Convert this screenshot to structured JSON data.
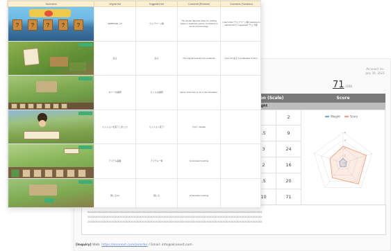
{
  "report": {
    "company": "Alconost Inc.",
    "date": "July 30, 2021",
    "score": "71",
    "score_max": "/100",
    "table": {
      "head_left": "ation (Scale)",
      "head_right": "Score",
      "sub_left": "ight",
      "rows": [
        {
          "left": ".5",
          "right": "9"
        },
        {
          "left": "3",
          "right": "24"
        },
        {
          "left": "2",
          "right": "16"
        },
        {
          "left": ".5",
          "right": "20"
        },
        {
          "left": "10",
          "right": "71"
        }
      ],
      "row0_right": "2"
    },
    "comment_lines": [
      "XXXXXXXXXXXXXXXXXXXXXXXXXXXXXXXXXXXXXXXXXXXXXXXXXXXXXXXXXXXXXXXXXXXXXXXXXXXXXXXXXXXXXXXXXXXXXXXXXXXXXXXXXXXXXX",
      "XXXXXXXXXXXXXXXXXXXXXXXXXXXXXXXXXXXXXXXXXXXXXXXXXXXXXXXXXXXXXXXXXXXXXXXXXXXXXXXXXXXXXXXXXXXXXXXXXXXXXXXXXXXXXX",
      "XXXXXXXXXXXXXXXXXXXXXXXXXXXXXXXXXXXXXXXXXXXXXXXXXXXXXXXXXXXXXXXXXXXXXXXXXXXXXXXXXXXXXXXXXXXXXXXXXXXXXXXXXXXXXX"
    ],
    "inquiry_label": "[Inquiry]",
    "inquiry_web_label": "Web:",
    "inquiry_url": "https://alconost.com/ja/order",
    "inquiry_email": "/ Email: info@alconost.com"
  },
  "chart_data": {
    "type": "radar",
    "title": "",
    "legend": [
      "Weight",
      "Score"
    ],
    "legend_position": "top",
    "axis_ticks": [
      "4",
      "3",
      "2",
      "1",
      "0"
    ],
    "spoke_labels": [
      "",
      "",
      "",
      "",
      ""
    ],
    "series": [
      {
        "name": "Weight",
        "values": [
          0.6,
          0.5,
          0.6,
          0.6,
          0.5
        ]
      },
      {
        "name": "Score",
        "values": [
          2.2,
          3.2,
          3.4,
          2.4,
          1.8
        ]
      }
    ],
    "rlim": [
      0,
      4
    ],
    "colors": {
      "Weight": "#7aa6d8",
      "Score": "#f0a078"
    }
  },
  "sheet": {
    "headers": [
      "Screenshot",
      "Original text",
      "Suggested text",
      "Comments (Reviewer)",
      "Comments (Translator)"
    ],
    "rows": [
      {
        "original": "WEBPAGE_1.0",
        "suggested": "ウェブページ版",
        "review": "The shorter label fits better for existing space in Japanese games. Consistent in terms of terminology.",
        "translator": "I don't think 'ウェブページ版' (website) is natural here? I suggested 'ウェブ版'."
      },
      {
        "original": "戻る",
        "suggested": "戻る",
        "review": "The original sounds a bit unnatural.",
        "translator": "How so? 戻る is a standard UI term."
      },
      {
        "original": "ホバーの説明",
        "suggested": "ヒントの説明",
        "review": "Name of the item is not in the translation.",
        "translator": ""
      },
      {
        "original": "ミッションを完了しました!",
        "suggested": "ミッション完了!",
        "review": "Typo / mistake",
        "translator": ""
      },
      {
        "original": "アイテム画面",
        "suggested": "アイテム一覧",
        "review": "Inconsistent wording",
        "translator": ""
      },
      {
        "original": "閉じる(X)",
        "suggested": "閉じる",
        "review": "Inconsistent wording",
        "translator": ""
      }
    ]
  },
  "colors": {
    "sheet_header": "#fdf0d2",
    "table_head": "#7a7a7a",
    "table_sub": "#bdbdbd",
    "link": "#6b8fc4"
  }
}
